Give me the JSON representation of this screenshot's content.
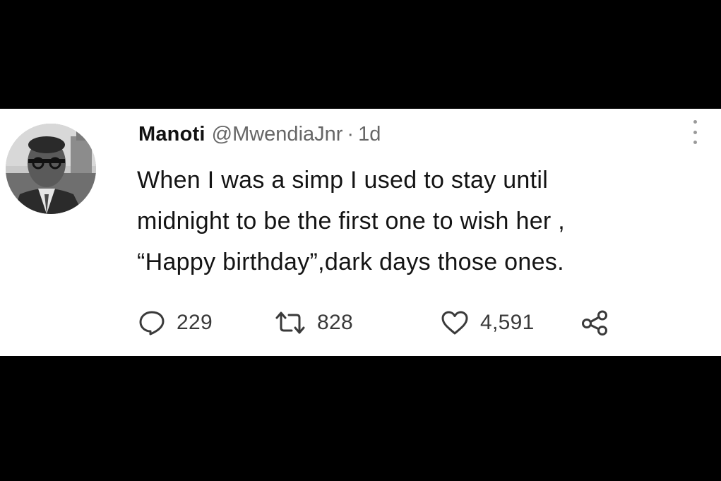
{
  "tweet": {
    "author": {
      "display_name": "Manoti",
      "handle": "@MwendiaJnr",
      "separator": "·",
      "time": "1d"
    },
    "text_lines": [
      "When I was a simp I used to stay until",
      "midnight to be the first one to wish her ,",
      "“Happy birthday”,dark days those ones."
    ],
    "actions": {
      "replies": "229",
      "retweets": "828",
      "likes": "4,591"
    },
    "icons": {
      "avatar": "avatar-photo",
      "more": "more-dots-icon",
      "reply": "reply-bubble-icon",
      "retweet": "retweet-arrows-icon",
      "like": "heart-icon",
      "share": "share-nodes-icon"
    },
    "colors": {
      "card_background": "#ffffff",
      "page_background": "#000000",
      "text_primary": "#141414",
      "text_secondary": "#666666"
    }
  }
}
